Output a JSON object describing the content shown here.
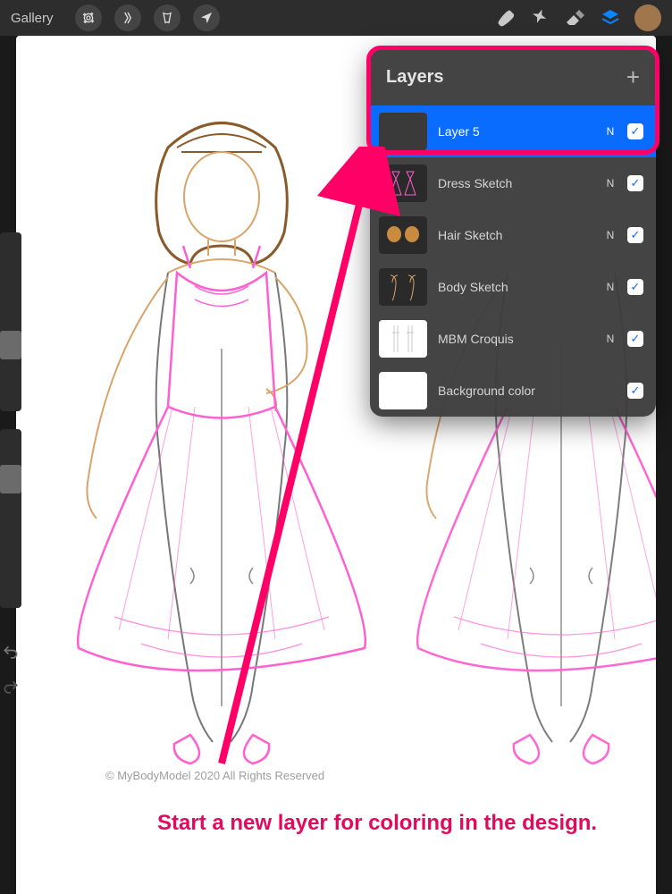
{
  "toolbar": {
    "gallery_label": "Gallery",
    "color_swatch": "#a0764d"
  },
  "layers_panel": {
    "title": "Layers",
    "layers": [
      {
        "name": "Layer 5",
        "mode": "N",
        "checked": true,
        "selected": true,
        "thumb": "blank"
      },
      {
        "name": "Dress Sketch",
        "mode": "N",
        "checked": true,
        "selected": false,
        "thumb": "dress"
      },
      {
        "name": "Hair Sketch",
        "mode": "N",
        "checked": true,
        "selected": false,
        "thumb": "hair"
      },
      {
        "name": "Body Sketch",
        "mode": "N",
        "checked": true,
        "selected": false,
        "thumb": "body"
      },
      {
        "name": "MBM Croquis",
        "mode": "N",
        "checked": true,
        "selected": false,
        "thumb": "croquis"
      },
      {
        "name": "Background color",
        "mode": "",
        "checked": true,
        "selected": false,
        "thumb": "white"
      }
    ]
  },
  "canvas": {
    "copyright": "© MyBodyModel 2020 All Rights Reserved"
  },
  "annotation": {
    "text": "Start a new layer for coloring in the design."
  },
  "colors": {
    "hair": "#8a5a2a",
    "skin": "#d9a46a",
    "dress": "#ff5fd1",
    "body_line": "#6a6a6a",
    "accent": "#e20a5e",
    "selection": "#0a6cff"
  }
}
